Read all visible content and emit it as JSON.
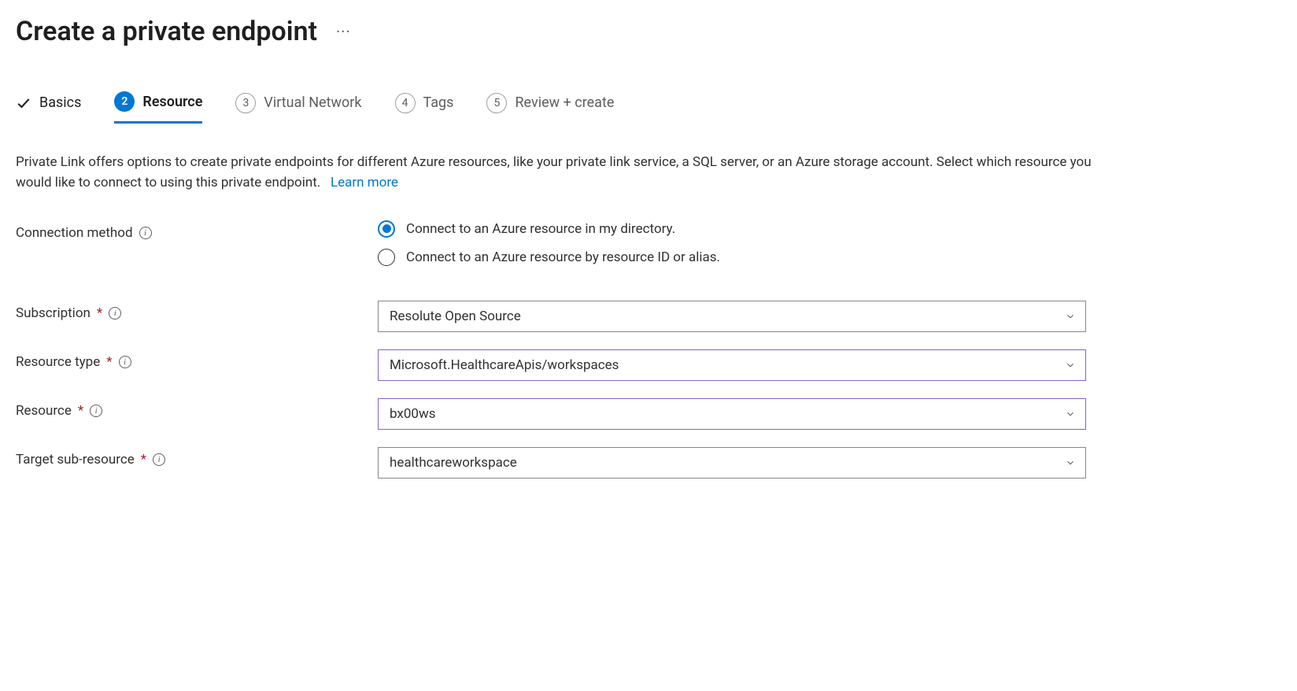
{
  "header": {
    "title": "Create a private endpoint"
  },
  "tabs": {
    "basics": "Basics",
    "resource_num": "2",
    "resource": "Resource",
    "vnet_num": "3",
    "vnet": "Virtual Network",
    "tags_num": "4",
    "tags": "Tags",
    "review_num": "5",
    "review": "Review + create"
  },
  "description": {
    "text": "Private Link offers options to create private endpoints for different Azure resources, like your private link service, a SQL server, or an Azure storage account. Select which resource you would like to connect to using this private endpoint.",
    "learn_more": "Learn more"
  },
  "form": {
    "connection_method_label": "Connection method",
    "radio_directory": "Connect to an Azure resource in my directory.",
    "radio_alias": "Connect to an Azure resource by resource ID or alias.",
    "subscription_label": "Subscription",
    "subscription_value": "Resolute Open Source",
    "resource_type_label": "Resource type",
    "resource_type_value": "Microsoft.HealthcareApis/workspaces",
    "resource_label": "Resource",
    "resource_value": "bx00ws",
    "target_sub_label": "Target sub-resource",
    "target_sub_value": "healthcareworkspace"
  }
}
